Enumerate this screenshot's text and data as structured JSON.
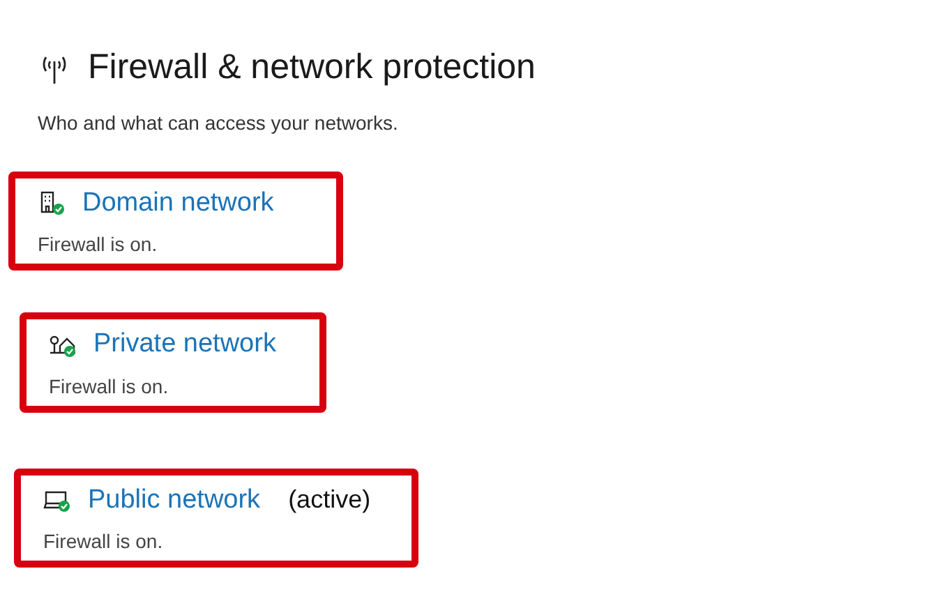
{
  "header": {
    "title": "Firewall & network protection",
    "subtitle": "Who and what can access your networks."
  },
  "networks": [
    {
      "kind": "domain",
      "name": "Domain network",
      "status": "Firewall is on.",
      "highlighted": true
    },
    {
      "kind": "private",
      "name": "Private network",
      "status": "Firewall is on.",
      "highlighted": true
    },
    {
      "kind": "public",
      "name": "Public network",
      "tag": "(active)",
      "status": "Firewall is on.",
      "highlighted": true
    }
  ]
}
